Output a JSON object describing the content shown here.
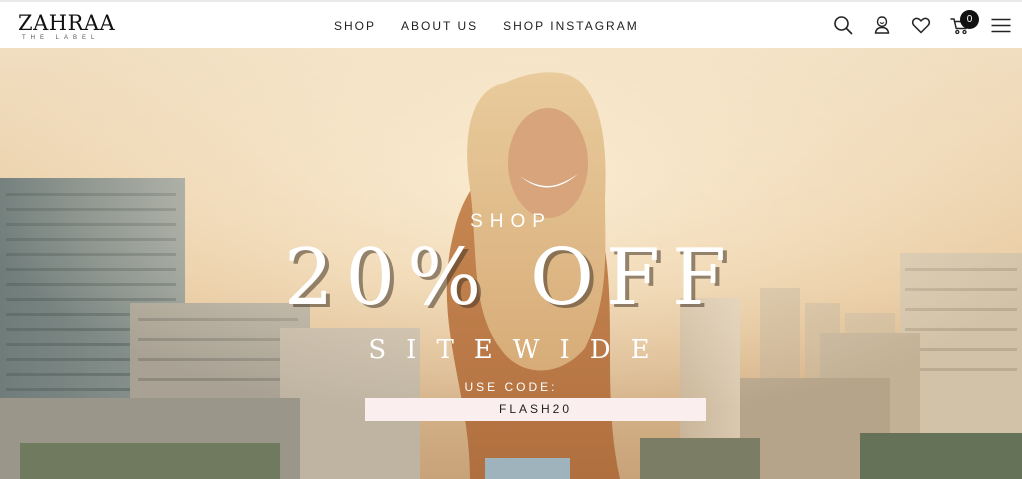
{
  "brand": {
    "name": "ZAHRAA",
    "tagline": "THE LABEL"
  },
  "nav": {
    "items": [
      {
        "label": "SHOP"
      },
      {
        "label": "ABOUT US"
      },
      {
        "label": "SHOP INSTAGRAM"
      }
    ]
  },
  "header_icons": [
    "search-icon",
    "account-icon",
    "wishlist-heart-icon",
    "cart-icon",
    "menu-icon"
  ],
  "cart": {
    "count": "0"
  },
  "hero": {
    "line1": "SHOP",
    "headline": "20% OFF",
    "line3": "SITEWIDE",
    "code_label": "USE CODE:",
    "code": "FLASH20"
  },
  "colors": {
    "header_bg": "#ffffff",
    "text_dark": "#222222",
    "badge_bg": "#111111",
    "code_box_bg": "#fbeeee",
    "hero_text": "#ffffff"
  }
}
